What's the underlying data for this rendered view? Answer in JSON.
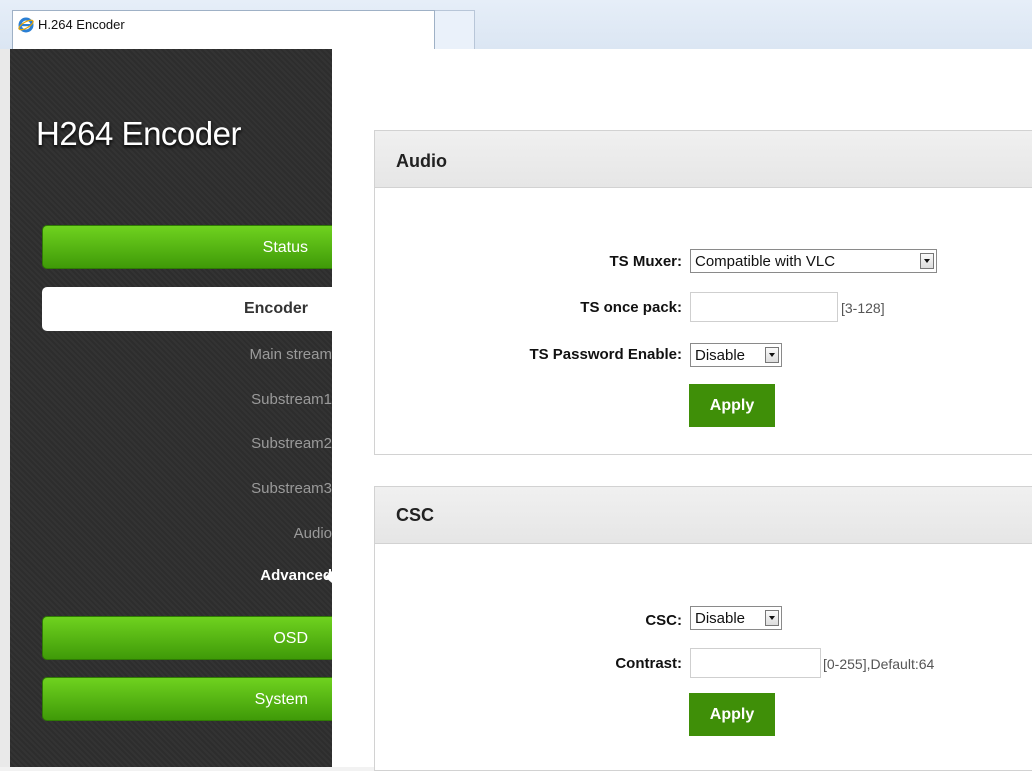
{
  "browser": {
    "tab_title": "H.264 Encoder",
    "tab_icon": "ie-browser-icon"
  },
  "sidebar": {
    "brand": "H264 Encoder",
    "nav": {
      "status": "Status",
      "encoder": "Encoder",
      "osd": "OSD",
      "system": "System"
    },
    "encoder_items": [
      "Main stream",
      "Substream1",
      "Substream2",
      "Substream3",
      "Audio",
      "Advanced"
    ],
    "selected_item": "Advanced"
  },
  "audio_panel": {
    "title": "Audio",
    "ts_muxer_label": "TS Muxer:",
    "ts_muxer_value": "Compatible with VLC",
    "ts_once_pack_label": "TS once pack:",
    "ts_once_pack_value": "",
    "ts_once_pack_hint": "[3-128]",
    "ts_password_label": "TS Password Enable:",
    "ts_password_value": "Disable",
    "apply_label": "Apply"
  },
  "csc_panel": {
    "title": "CSC",
    "csc_label": "CSC:",
    "csc_value": "Disable",
    "contrast_label": "Contrast:",
    "contrast_value": "",
    "contrast_hint": "[0-255],Default:64",
    "apply_label": "Apply"
  },
  "colors": {
    "accent_green": "#3f8f08",
    "sidebar_bg": "#2e2e2e"
  }
}
